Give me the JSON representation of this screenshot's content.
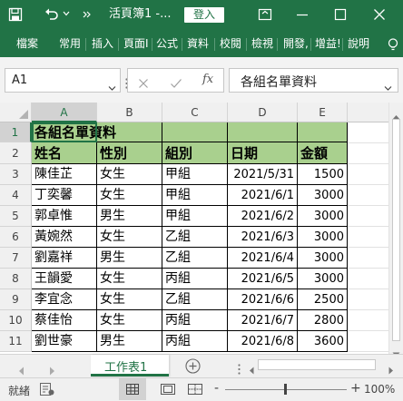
{
  "titlebar": {
    "title": "活頁簿1 -...",
    "login_label": "登入",
    "undo_dropdown_icon": "chevron-down-icon"
  },
  "ribbon": {
    "tabs": [
      "檔案",
      "常用",
      "插入",
      "頁面配置",
      "公式",
      "資料",
      "校閱",
      "檢視",
      "開發人員",
      "增益集",
      "說明"
    ],
    "tab_display": [
      "檔案",
      "常用",
      "插入",
      "頁面I",
      "公式",
      "資料",
      "校閱",
      "檢視",
      "開發,",
      "增益!",
      "說明"
    ]
  },
  "formula_bar": {
    "name_box": "A1",
    "fx_label": "fx",
    "content": "各組名單資料"
  },
  "columns": [
    "A",
    "B",
    "C",
    "D",
    "E"
  ],
  "rows": [
    "1",
    "2",
    "3",
    "4",
    "5",
    "6",
    "7",
    "8",
    "9",
    "10",
    "11"
  ],
  "sheet": {
    "title": "各組名單資料",
    "headers": [
      "姓名",
      "性別",
      "組別",
      "日期",
      "金額"
    ],
    "data": [
      [
        "陳佳芷",
        "女生",
        "甲組",
        "2021/5/31",
        "1500"
      ],
      [
        "丁奕馨",
        "女生",
        "甲組",
        "2021/6/1",
        "3000"
      ],
      [
        "郭卓惟",
        "男生",
        "甲組",
        "2021/6/2",
        "3000"
      ],
      [
        "黃婉然",
        "女生",
        "乙組",
        "2021/6/3",
        "3000"
      ],
      [
        "劉嘉祥",
        "男生",
        "乙組",
        "2021/6/4",
        "3000"
      ],
      [
        "王韻愛",
        "女生",
        "丙組",
        "2021/6/5",
        "3000"
      ],
      [
        "李宜念",
        "女生",
        "乙組",
        "2021/6/6",
        "2500"
      ],
      [
        "蔡佳怡",
        "女生",
        "丙組",
        "2021/6/7",
        "2800"
      ],
      [
        "劉世豪",
        "男生",
        "丙組",
        "2021/6/8",
        "3600"
      ]
    ]
  },
  "sheet_tabs": {
    "active": "工作表1",
    "add_label": "+"
  },
  "status": {
    "mode": "就緒",
    "zoom": "100%",
    "zoom_minus": "-",
    "zoom_plus": "+"
  },
  "colors": {
    "brand": "#217346",
    "header_fill": "#a9d08e"
  }
}
